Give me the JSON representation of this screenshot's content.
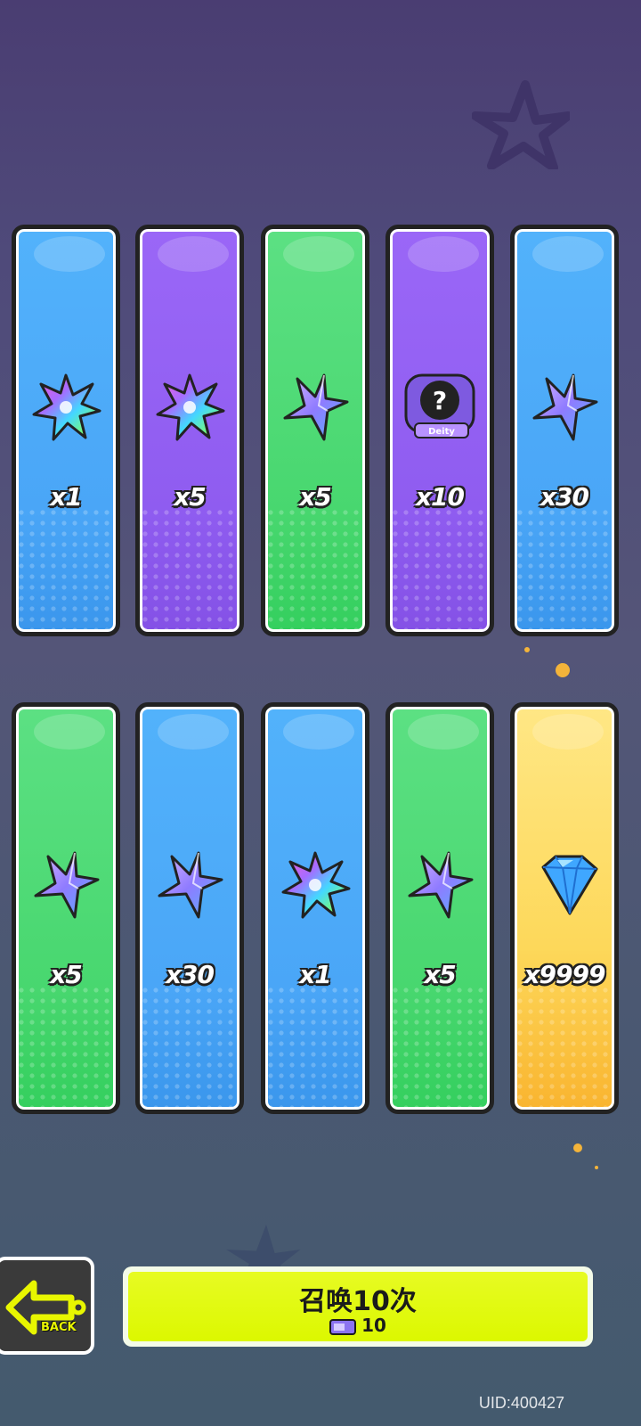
{
  "reward_rows": [
    [
      {
        "theme": "blue",
        "icon": "rainbow-crystal-icon",
        "qty": "x1"
      },
      {
        "theme": "purple",
        "icon": "rainbow-crystal-icon",
        "qty": "x5"
      },
      {
        "theme": "green",
        "icon": "star-shard-icon",
        "qty": "x5"
      },
      {
        "theme": "purple",
        "icon": "mystery-puzzle-icon",
        "qty": "x10",
        "badge": "Deity"
      },
      {
        "theme": "blue",
        "icon": "star-shard-icon",
        "qty": "x30"
      }
    ],
    [
      {
        "theme": "green",
        "icon": "star-shard-icon",
        "qty": "x5"
      },
      {
        "theme": "blue",
        "icon": "star-shard-icon",
        "qty": "x30"
      },
      {
        "theme": "blue",
        "icon": "rainbow-crystal-icon",
        "qty": "x1"
      },
      {
        "theme": "green",
        "icon": "star-shard-icon",
        "qty": "x5"
      },
      {
        "theme": "gold",
        "icon": "diamond-gem-icon",
        "qty": "x9999"
      }
    ]
  ],
  "back_button": {
    "label": "BACK",
    "icon": "back-arrow-icon"
  },
  "summon_button": {
    "title": "召唤10次",
    "cost": "10",
    "cost_icon": "summon-ticket-icon"
  },
  "uid": "UID:400427",
  "colors": {
    "blue": "#4aa6f7",
    "purple": "#8f5cf0",
    "green": "#48d76f",
    "gold": "#fdd85a",
    "accent": "#dcf800"
  }
}
